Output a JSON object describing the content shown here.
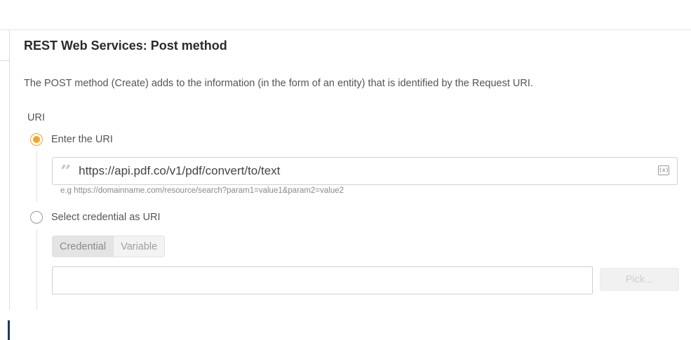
{
  "section": {
    "title": "REST Web Services: Post method",
    "description": "The POST method (Create) adds to the information (in the form of an entity) that is identified by the Request URI."
  },
  "uri": {
    "label": "URI",
    "option_enter": {
      "label": "Enter the URI",
      "selected": true
    },
    "input": {
      "value": "https://api.pdf.co/v1/pdf/convert/to/text",
      "variable_icon": "(x)"
    },
    "hint": "e.g https://domainname.com/resource/search?param1=value1&param2=value2",
    "option_credential": {
      "label": "Select credential as URI",
      "selected": false
    }
  },
  "credential": {
    "tabs": [
      {
        "label": "Credential",
        "active": true
      },
      {
        "label": "Variable",
        "active": false
      }
    ],
    "input_value": "",
    "pick_label": "Pick..."
  },
  "icons": {
    "quote": "quote-icon",
    "variable": "variable-icon"
  },
  "colors": {
    "accent": "#f6a623",
    "sidebar_marker": "#1f3a57"
  }
}
